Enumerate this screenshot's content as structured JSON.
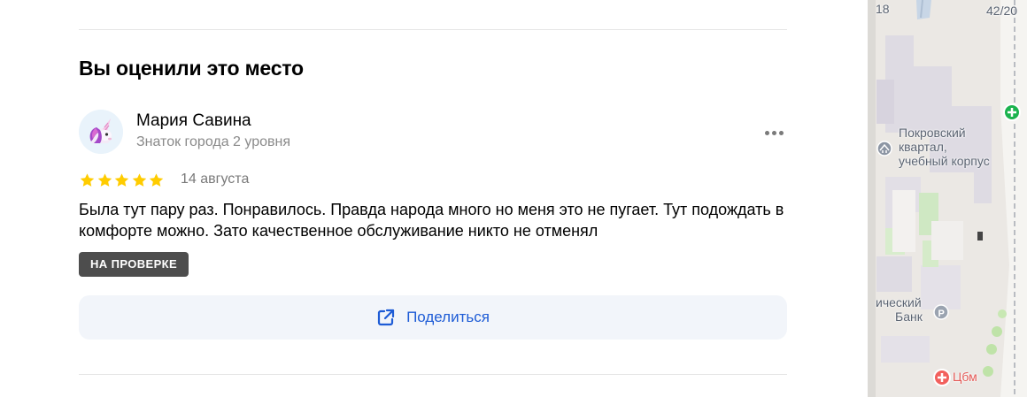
{
  "section": {
    "title": "Вы оценили это место"
  },
  "review": {
    "author_name": "Мария Савина",
    "author_level": "Знаток города 2 уровня",
    "rating": 5,
    "rating_max": 5,
    "date": "14 августа",
    "text": "Была тут пару раз. Понравилось. Правда народа много но меня это не пугает. Тут подождать в комфорте можно. Зато качественное обслуживание никто не отменял",
    "status": "НА ПРОВЕРКЕ"
  },
  "actions": {
    "share_label": "Поделиться"
  },
  "map": {
    "labels": {
      "house_18": "18",
      "house_42_20": "42/20",
      "place_line1": "Покровский",
      "place_line2": "квартал,",
      "place_line3": "учебный корпус",
      "bank_line1": "ический",
      "bank_line2": "Банк",
      "clinic": "Цбм"
    }
  },
  "colors": {
    "star": "#ffcc00",
    "accent": "#1e5cd6",
    "badge": "#4d4d4d",
    "share_bg": "#f2f5fa",
    "map_pin_green": "#1bb34e",
    "map_pin_red": "#f2605d"
  },
  "icons": {
    "avatar": "unicorn-avatar-icon",
    "more": "more-dots-icon",
    "share": "share-external-icon",
    "star": "star-icon"
  }
}
